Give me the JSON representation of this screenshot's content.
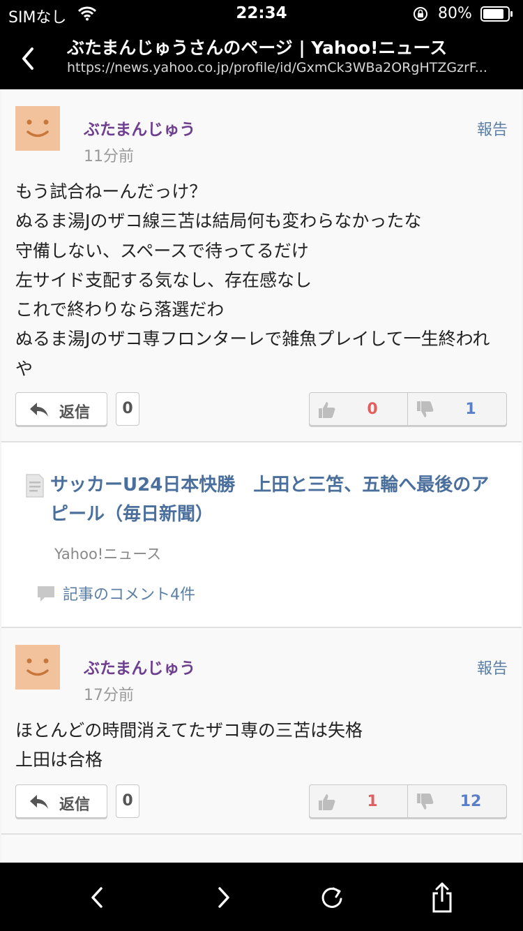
{
  "status_bar": {
    "carrier": "SIMなし",
    "time": "22:34",
    "battery": "80%"
  },
  "nav": {
    "title": "ぶたまんじゅうさんのページ | Yahoo!ニュース",
    "url": "https://news.yahoo.co.jp/profile/id/GxmCk3WBa2ORgHTZGzrF..."
  },
  "comments": [
    {
      "user": "ぶたまんじゅう",
      "time_ago": "11分前",
      "report_label": "報告",
      "text": "もう試合ねーんだっけ？\nぬるま湯JのザコI線三苫は結局何も変わらなかったな\n守備しない、スペースで待ってるだけ\n左サイド支配する気なし、存在感なし\nこれで終わりなら落選だわ\nぬるま湯Jのザコ専フロンターレで雑魚プレイして一生終われや",
      "reply_label": "返信",
      "reply_count": "0",
      "likes": "0",
      "dislikes": "1"
    },
    {
      "user": "ぶたまんじゅう",
      "time_ago": "17分前",
      "report_label": "報告",
      "text": "ほとんどの時間消えてたザコ専の三苫は失格\n上田は合格",
      "reply_label": "返信",
      "reply_count": "0",
      "likes": "1",
      "dislikes": "12"
    }
  ],
  "article": {
    "title": "サッカーU24日本快勝　上田と三笘、五輪へ最後のアピール（毎日新聞）",
    "source": "Yahoo!ニュース",
    "comments_link": "記事のコメント4件"
  },
  "colors": {
    "user_name": "#6e3f8f",
    "link": "#5b7fa6",
    "like": "#e06060",
    "dislike": "#5b7fc6",
    "avatar": "#f1c29c"
  }
}
